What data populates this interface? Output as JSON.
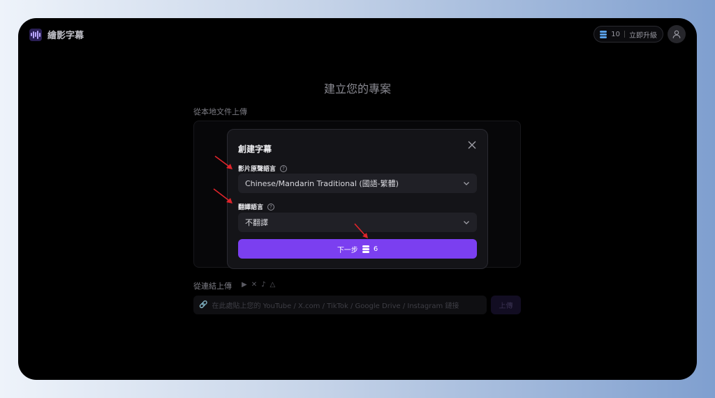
{
  "app": {
    "name": "繪影字幕"
  },
  "header": {
    "credits": "10",
    "upgrade_label": "立即升級"
  },
  "page": {
    "title": "建立您的專案",
    "local_upload_label": "從本地文件上傳",
    "link_upload_label": "從連結上傳",
    "url_placeholder": "在此處貼上您的 YouTube / X.com / TikTok / Google Drive / Instagram 鏈接",
    "upload_button": "上傳"
  },
  "modal": {
    "title": "創建字幕",
    "source_language_label": "影片原聲語言",
    "source_language_value": "Chinese/Mandarin Traditional (國語-繁體)",
    "translate_language_label": "翻譯語言",
    "translate_language_value": "不翻譯",
    "next_button_label": "下一步",
    "next_button_cost": "6"
  },
  "colors": {
    "accent": "#7b3ff0",
    "annotation": "#e0242b"
  }
}
